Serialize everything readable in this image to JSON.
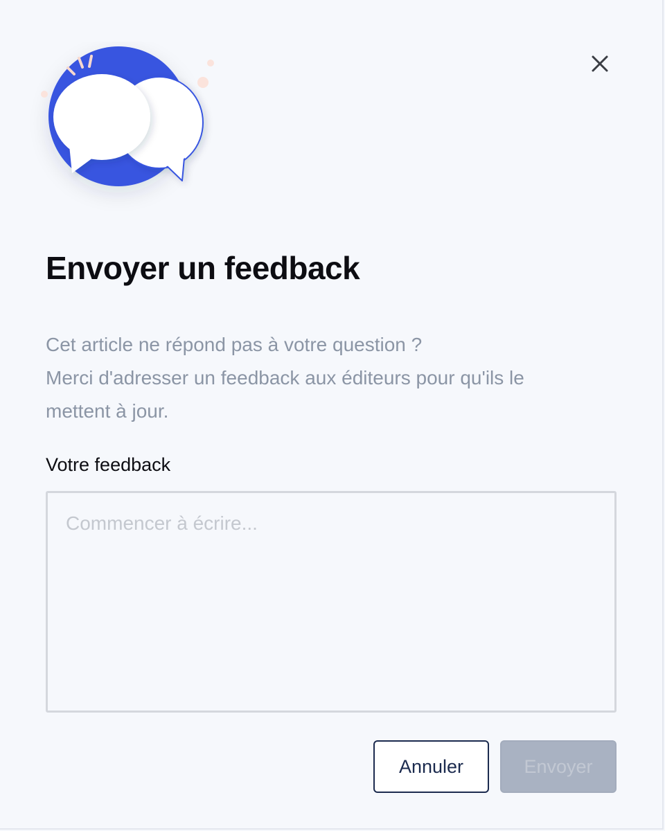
{
  "dialog": {
    "title": "Envoyer un feedback",
    "description": [
      "Cet article ne répond pas à votre question ?",
      "Merci d'adresser un feedback aux éditeurs pour qu'ils le",
      "mettent à jour."
    ],
    "field_label": "Votre feedback",
    "textarea": {
      "value": "",
      "placeholder": "Commencer à écrire..."
    },
    "buttons": {
      "cancel_label": "Annuler",
      "send_label": "Envoyer",
      "send_disabled": true
    },
    "icons": {
      "close": "close-icon",
      "illustration": "chat-bubbles-illustration"
    },
    "colors": {
      "accent": "#3754e0",
      "background": "#f6f8fc",
      "muted_text": "#8b95a5",
      "primary_dark": "#1b2a4e",
      "disabled_button": "#a9b2c2"
    }
  }
}
